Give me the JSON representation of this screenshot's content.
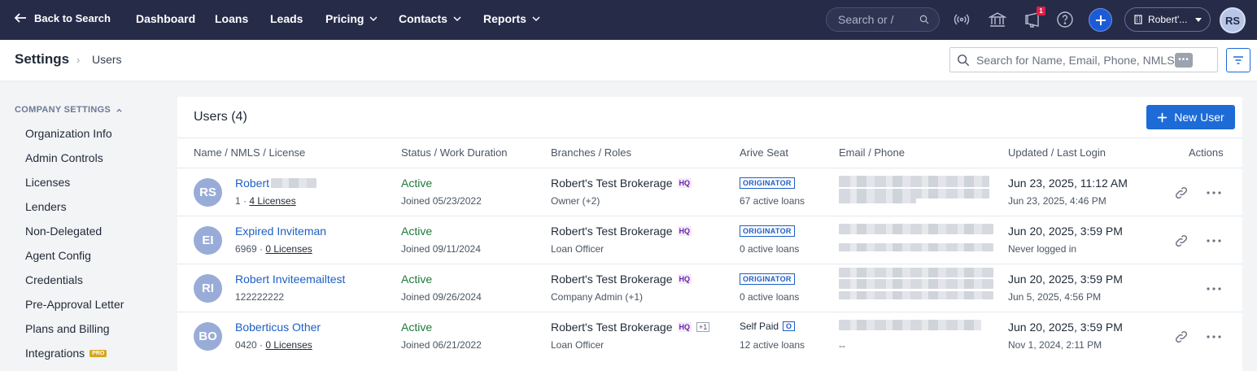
{
  "topnav": {
    "back_label": "Back to Search",
    "items": [
      {
        "label": "Dashboard"
      },
      {
        "label": "Loans"
      },
      {
        "label": "Leads"
      },
      {
        "label": "Pricing"
      },
      {
        "label": "Contacts"
      },
      {
        "label": "Reports"
      }
    ],
    "search_placeholder": "Search or /",
    "notification_count": "1",
    "org_name": "Robert'...",
    "user_initials": "RS",
    "icons": [
      "broadcast-icon",
      "bank-icon",
      "announcement-icon",
      "help-icon",
      "plus-icon"
    ]
  },
  "breadcrumb": {
    "root": "Settings",
    "separator": "›",
    "current": "Users"
  },
  "user_search": {
    "placeholder": "Search for Name, Email, Phone, NMLS"
  },
  "sidebar": {
    "section_title": "COMPANY SETTINGS",
    "items": [
      {
        "label": "Organization Info"
      },
      {
        "label": "Admin Controls"
      },
      {
        "label": "Licenses"
      },
      {
        "label": "Lenders"
      },
      {
        "label": "Non-Delegated"
      },
      {
        "label": "Agent Config"
      },
      {
        "label": "Credentials"
      },
      {
        "label": "Pre-Approval Letter"
      },
      {
        "label": "Plans and Billing"
      },
      {
        "label": "Integrations",
        "badge": "PRO"
      }
    ]
  },
  "users_table": {
    "title": "Users (4)",
    "new_button": "New User",
    "columns": [
      "Name / NMLS / License",
      "Status / Work Duration",
      "Branches / Roles",
      "Arive Seat",
      "Email / Phone",
      "Updated / Last Login",
      "Actions"
    ],
    "rows": [
      {
        "initials": "RS",
        "name": "Robert",
        "nmls": "1",
        "licenses": "4 Licenses",
        "status": "Active",
        "joined": "Joined 05/23/2022",
        "branch": "Robert's Test Brokerage",
        "hq": "HQ",
        "extra_branches": "",
        "role": "Owner (+2)",
        "seat": "ORIGINATOR",
        "seat_type": "tag",
        "loans": "67 active loans",
        "email_placeholder": "",
        "updated": "Jun 23, 2025, 11:12 AM",
        "last_login": "Jun 23, 2025, 4:46 PM",
        "has_link": true
      },
      {
        "initials": "EI",
        "name": "Expired Inviteman",
        "nmls": "6969",
        "licenses": "0 Licenses",
        "status": "Active",
        "joined": "Joined 09/11/2024",
        "branch": "Robert's Test Brokerage",
        "hq": "HQ",
        "extra_branches": "",
        "role": "Loan Officer",
        "seat": "ORIGINATOR",
        "seat_type": "tag",
        "loans": "0 active loans",
        "email_placeholder": "",
        "updated": "Jun 20, 2025, 3:59 PM",
        "last_login": "Never logged in",
        "has_link": true
      },
      {
        "initials": "RI",
        "name": "Robert Inviteemailtest",
        "nmls": "122222222",
        "licenses": "",
        "status": "Active",
        "joined": "Joined 09/26/2024",
        "branch": "Robert's Test Brokerage",
        "hq": "HQ",
        "extra_branches": "",
        "role": "Company Admin (+1)",
        "seat": "ORIGINATOR",
        "seat_type": "tag",
        "loans": "0 active loans",
        "email_placeholder": "",
        "updated": "Jun 20, 2025, 3:59 PM",
        "last_login": "Jun 5, 2025, 4:56 PM",
        "has_link": false
      },
      {
        "initials": "BO",
        "name": "Boberticus Other",
        "nmls": "0420",
        "licenses": "0 Licenses",
        "status": "Active",
        "joined": "Joined 06/21/2022",
        "branch": "Robert's Test Brokerage",
        "hq": "HQ",
        "extra_branches": "+1",
        "role": "Loan Officer",
        "seat": "Self Paid",
        "seat_badge": "O",
        "seat_type": "text",
        "loans": "12 active loans",
        "email_placeholder": "--",
        "updated": "Jun 20, 2025, 3:59 PM",
        "last_login": "Nov 1, 2024, 2:11 PM",
        "has_link": true
      }
    ]
  },
  "colors": {
    "nav_bg": "#262b48",
    "primary": "#1d6bd6",
    "link": "#1d5fc4",
    "status_active": "#1f7a3a",
    "avatar": "#99acd8",
    "hq": "#6b21a8"
  }
}
